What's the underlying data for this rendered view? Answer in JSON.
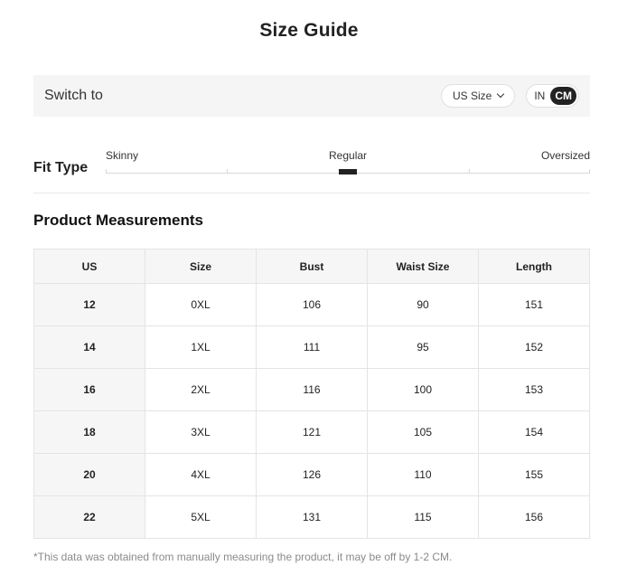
{
  "title": "Size Guide",
  "switch": {
    "label": "Switch to",
    "size_system": "US Size",
    "units": [
      "IN",
      "CM"
    ],
    "active_unit": "CM"
  },
  "fit": {
    "label": "Fit Type",
    "options": [
      "Skinny",
      "Regular",
      "Oversized"
    ],
    "selected": "Regular"
  },
  "measurements": {
    "title": "Product Measurements",
    "columns": [
      "US",
      "Size",
      "Bust",
      "Waist Size",
      "Length"
    ],
    "rows": [
      [
        "12",
        "0XL",
        "106",
        "90",
        "151"
      ],
      [
        "14",
        "1XL",
        "111",
        "95",
        "152"
      ],
      [
        "16",
        "2XL",
        "116",
        "100",
        "153"
      ],
      [
        "18",
        "3XL",
        "121",
        "105",
        "154"
      ],
      [
        "20",
        "4XL",
        "126",
        "110",
        "155"
      ],
      [
        "22",
        "5XL",
        "131",
        "115",
        "156"
      ]
    ]
  },
  "footnote": "*This data was obtained from manually measuring the product, it may be off by 1-2 CM.",
  "colors": {
    "accent": "#222222",
    "panel": "#f5f5f5",
    "muted": "#8a8a8a"
  }
}
